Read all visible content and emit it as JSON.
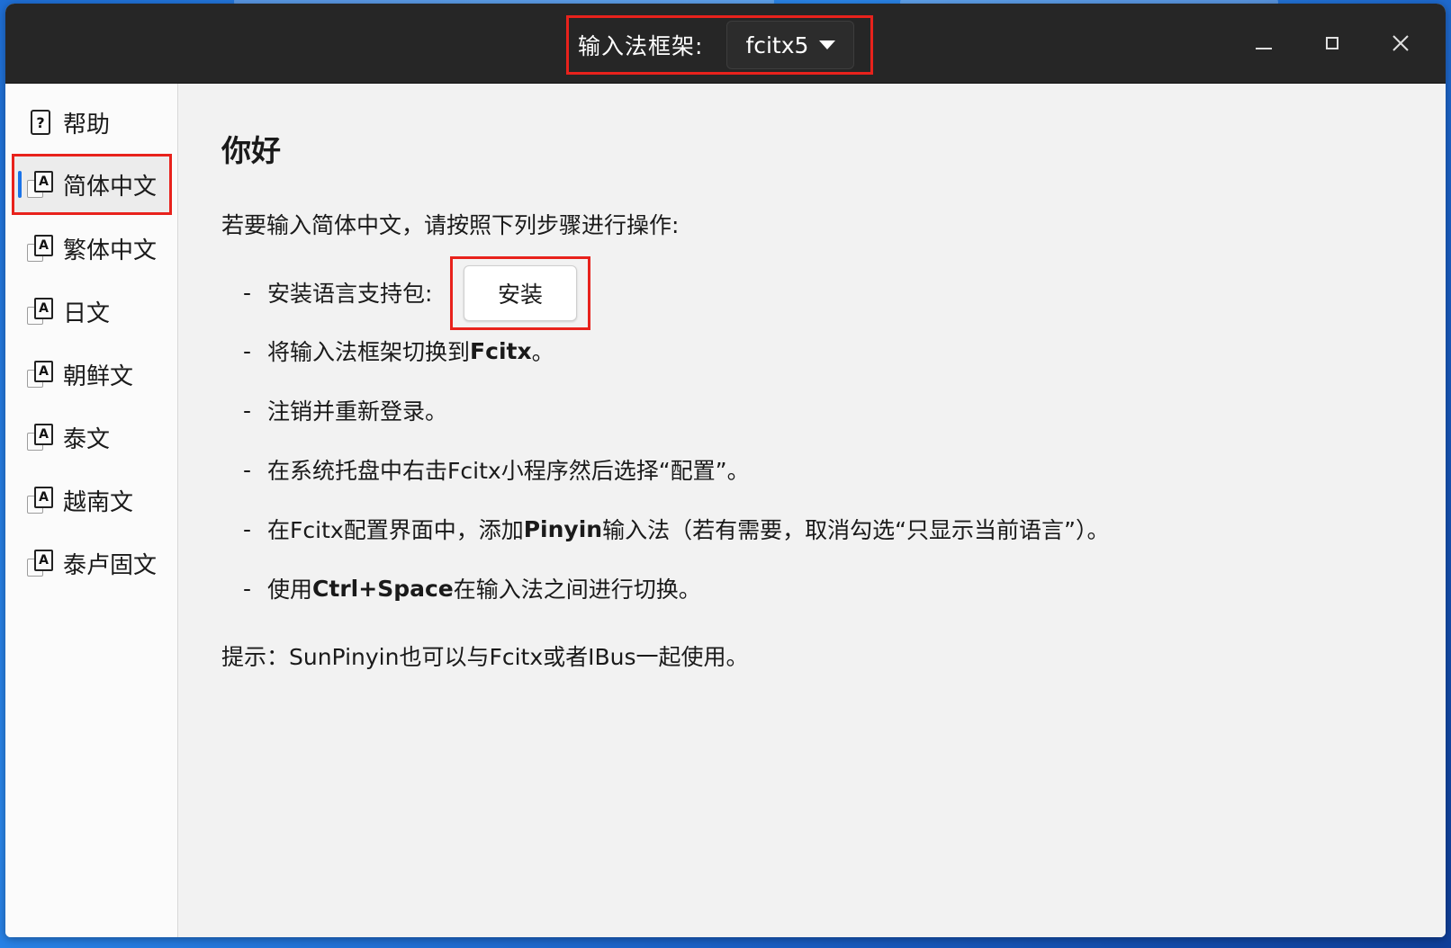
{
  "titlebar": {
    "framework_label": "输入法框架:",
    "framework_value": "fcitx5"
  },
  "sidebar": {
    "items": [
      {
        "label": "帮助",
        "icon": "help-icon"
      },
      {
        "label": "简体中文",
        "icon": "language-icon",
        "active": true
      },
      {
        "label": "繁体中文",
        "icon": "language-icon"
      },
      {
        "label": "日文",
        "icon": "language-icon"
      },
      {
        "label": "朝鲜文",
        "icon": "language-icon"
      },
      {
        "label": "泰文",
        "icon": "language-icon"
      },
      {
        "label": "越南文",
        "icon": "language-icon"
      },
      {
        "label": "泰卢固文",
        "icon": "language-icon"
      }
    ]
  },
  "main": {
    "heading": "你好",
    "intro": "若要输入简体中文，请按照下列步骤进行操作:",
    "steps": {
      "s1": "安装语言支持包:",
      "install_button": "安装",
      "s2_prefix": "将输入法框架切换到",
      "s2_bold": "Fcitx",
      "s2_suffix": "。",
      "s3": "注销并重新登录。",
      "s4": "在系统托盘中右击Fcitx小程序然后选择“配置”。",
      "s5_prefix": "在Fcitx配置界面中，添加",
      "s5_bold": "Pinyin",
      "s5_suffix": "输入法（若有需要，取消勾选“只显示当前语言”）。",
      "s6_prefix": "使用",
      "s6_bold": "Ctrl+Space",
      "s6_suffix": "在输入法之间进行切换。"
    },
    "tip": "提示：SunPinyin也可以与Fcitx或者IBus一起使用。"
  },
  "colors": {
    "titlebar_bg": "#262626",
    "highlight": "#e8221c",
    "active_indicator": "#1a73e8"
  }
}
